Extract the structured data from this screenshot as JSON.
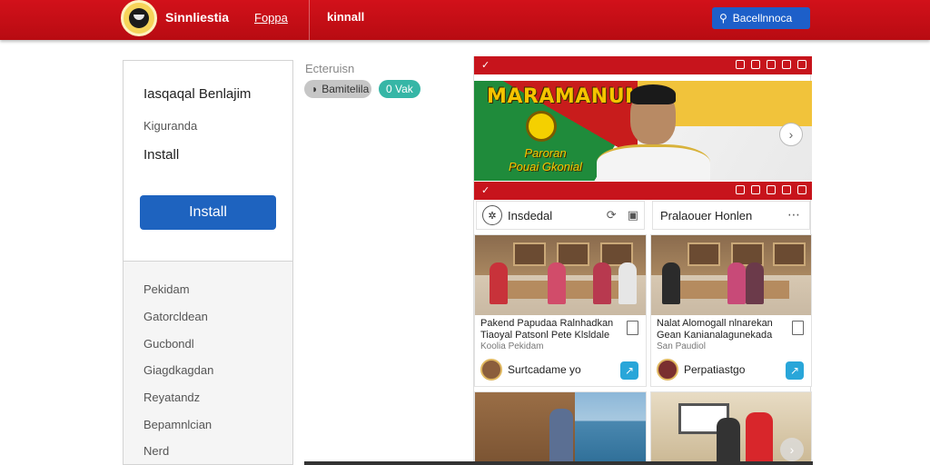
{
  "header": {
    "brand": "Sinnliestia",
    "nav_link": "Foppa",
    "nav_title": "kinnall",
    "action_button": "Bacellnnoca",
    "action_icon": "pin-icon"
  },
  "sidebar": {
    "title": "Iasqaqal Benlajim",
    "subtitle": "Kiguranda",
    "install_label": "Install",
    "install_button": "Install",
    "items": [
      "Pekidam",
      "Gatorcldean",
      "Gucbondl",
      "Giagdkagdan",
      "Reyatandz",
      "Bepamnlcian",
      "Nerd"
    ]
  },
  "middle": {
    "heading": "Ecteruisn",
    "tags": [
      {
        "label": "Bamitelila",
        "icon": "chat-icon"
      },
      {
        "label": "0 Vak"
      }
    ]
  },
  "panel": {
    "banner": {
      "title": "MARAMANUMAI",
      "subtitle_line1": "Paroran",
      "subtitle_line2": "Pouai Gkonial"
    },
    "columns": [
      {
        "title": "Insdedal"
      },
      {
        "title": "Pralaouer Honlen"
      }
    ],
    "cards": [
      {
        "title": "Pakend Papudaa Ralnhadkan Tiaoyal Patsonl Pete Klsldale",
        "meta": "Koolia Pekidam",
        "author": "Surtcadame yo"
      },
      {
        "title": "Nalat Alomogall nlnarekan Gean Kanianalagunekada",
        "meta": "San Paudiol",
        "author": "Perpatiastgo"
      }
    ]
  },
  "colors": {
    "header_red": "#c7141c",
    "button_blue": "#1e63bf",
    "teal_tag": "#36b6a6"
  }
}
